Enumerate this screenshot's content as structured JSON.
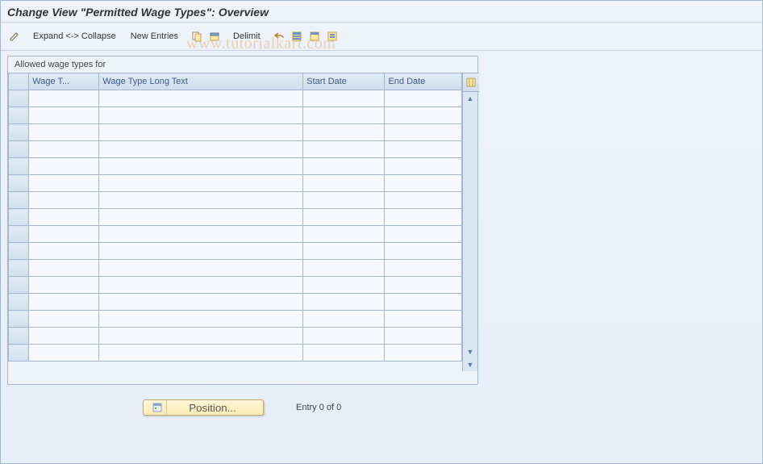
{
  "title": "Change View \"Permitted Wage Types\": Overview",
  "toolbar": {
    "pencil_tip": "Change",
    "expand_collapse": "Expand <-> Collapse",
    "new_entries": "New Entries",
    "delimit": "Delimit",
    "icons": {
      "copy": "copy-icon",
      "delete": "delete-icon",
      "undo": "undo-icon",
      "select_all": "select-all-icon",
      "deselect_all": "deselect-all-icon",
      "print": "print-icon"
    }
  },
  "panel": {
    "title": "Allowed wage types for",
    "columns": {
      "wage_type": "Wage T...",
      "long_text": "Wage Type Long Text",
      "start_date": "Start Date",
      "end_date": "End Date"
    },
    "rows": [
      {
        "wage_type": "",
        "long_text": "",
        "start_date": "",
        "end_date": ""
      },
      {
        "wage_type": "",
        "long_text": "",
        "start_date": "",
        "end_date": ""
      },
      {
        "wage_type": "",
        "long_text": "",
        "start_date": "",
        "end_date": ""
      },
      {
        "wage_type": "",
        "long_text": "",
        "start_date": "",
        "end_date": ""
      },
      {
        "wage_type": "",
        "long_text": "",
        "start_date": "",
        "end_date": ""
      },
      {
        "wage_type": "",
        "long_text": "",
        "start_date": "",
        "end_date": ""
      },
      {
        "wage_type": "",
        "long_text": "",
        "start_date": "",
        "end_date": ""
      },
      {
        "wage_type": "",
        "long_text": "",
        "start_date": "",
        "end_date": ""
      },
      {
        "wage_type": "",
        "long_text": "",
        "start_date": "",
        "end_date": ""
      },
      {
        "wage_type": "",
        "long_text": "",
        "start_date": "",
        "end_date": ""
      },
      {
        "wage_type": "",
        "long_text": "",
        "start_date": "",
        "end_date": ""
      },
      {
        "wage_type": "",
        "long_text": "",
        "start_date": "",
        "end_date": ""
      },
      {
        "wage_type": "",
        "long_text": "",
        "start_date": "",
        "end_date": ""
      },
      {
        "wage_type": "",
        "long_text": "",
        "start_date": "",
        "end_date": ""
      },
      {
        "wage_type": "",
        "long_text": "",
        "start_date": "",
        "end_date": ""
      },
      {
        "wage_type": "",
        "long_text": "",
        "start_date": "",
        "end_date": ""
      }
    ]
  },
  "position_button": "Position...",
  "entry_counter": "Entry 0 of 0",
  "watermark": "www.tutorialkart.com"
}
